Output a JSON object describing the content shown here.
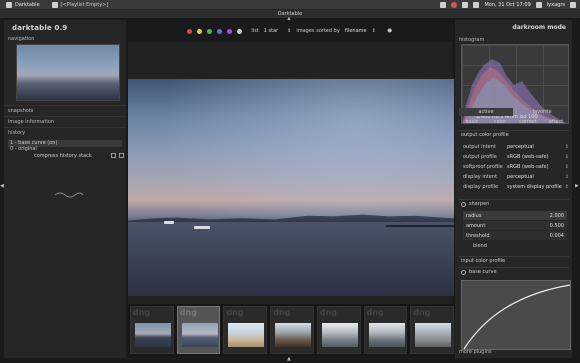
{
  "os_bar": {
    "apps": [
      {
        "label": "Darktable"
      },
      {
        "label": "[<Playlist Empty>]"
      }
    ],
    "clock": "Mon, 31 Oct  17:09",
    "user": "lyxagrs"
  },
  "window": {
    "title": "Darktable"
  },
  "left_panel": {
    "logo": "darktable 0.9",
    "navigation_label": "navigation",
    "sections": {
      "snapshots": "snapshots",
      "image_information": "image information",
      "history": "history"
    },
    "history_items": [
      {
        "label": "1 - base curve (on)"
      },
      {
        "label": "0 - original"
      }
    ],
    "compress_label": "compress history stack"
  },
  "top_bar": {
    "color_labels": [
      "#e04848",
      "#d6d04a",
      "#4fb84f",
      "#4f7fd6",
      "#b04fd6",
      "#c9c9c9"
    ],
    "list_label": "list",
    "rating_value": "1 star",
    "sort_label": "images sorted by",
    "sort_value": "filename"
  },
  "filmstrip": {
    "thumbs": [
      {
        "tag": "dng",
        "selected": false
      },
      {
        "tag": "dng",
        "selected": true
      },
      {
        "tag": "dng",
        "selected": false
      },
      {
        "tag": "dng",
        "selected": false
      },
      {
        "tag": "dng",
        "selected": false
      },
      {
        "tag": "dng",
        "selected": false
      },
      {
        "tag": "dng",
        "selected": false
      }
    ]
  },
  "right_panel": {
    "mode": "darkroom mode",
    "histogram_label": "histogram",
    "histogram_info": "1/400 f/6.5 4mm iso 100",
    "tabs_top": [
      "active",
      "favorite"
    ],
    "tabs_bottom": [
      "basic",
      "color",
      "correct",
      "effect"
    ],
    "output_color_profile": {
      "title": "output color profile",
      "rows": [
        {
          "label": "output intent",
          "value": "perceptual"
        },
        {
          "label": "output profile",
          "value": "sRGB (web-safe)"
        },
        {
          "label": "softproof profile",
          "value": "sRGB (web-safe)"
        },
        {
          "label": "display intent",
          "value": "perceptual"
        },
        {
          "label": "display profile",
          "value": "system display profile"
        }
      ]
    },
    "sharpen": {
      "title": "sharpen",
      "sliders": [
        {
          "label": "radius",
          "value": "2.000"
        },
        {
          "label": "amount",
          "value": "0.500"
        },
        {
          "label": "threshold",
          "value": "0.004"
        }
      ],
      "blend_label": "blend"
    },
    "input_color_profile": "input color profile",
    "base_curve": "base curve",
    "more_plugins": "more plugins"
  }
}
